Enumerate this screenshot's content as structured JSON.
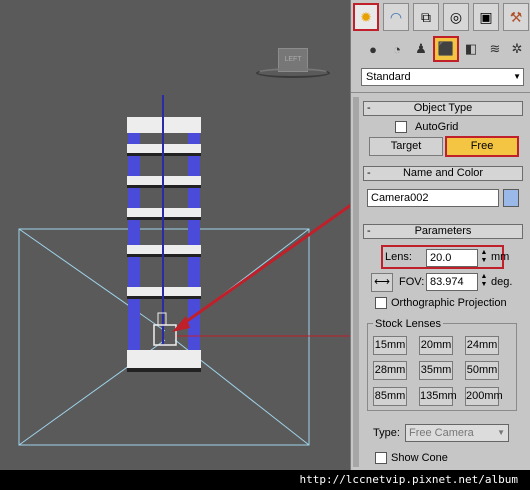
{
  "viewport": {
    "viewcube_label": "LEFT"
  },
  "panel": {
    "tabs": [
      {
        "name": "create",
        "icon": "sun-icon"
      },
      {
        "name": "modify",
        "icon": "arc-icon"
      },
      {
        "name": "hierarchy",
        "icon": "tree-icon"
      },
      {
        "name": "motion",
        "icon": "motion-icon"
      },
      {
        "name": "display",
        "icon": "monitor-icon"
      },
      {
        "name": "utilities",
        "icon": "hammer-icon"
      }
    ],
    "category_dropdown": "Standard",
    "object_type": {
      "title": "Object Type",
      "autogrid_label": "AutoGrid",
      "target_label": "Target",
      "free_label": "Free"
    },
    "name_and_color": {
      "title": "Name and Color",
      "name_value": "Camera002",
      "color": "#9bb9e8"
    },
    "parameters": {
      "title": "Parameters",
      "lens_label": "Lens:",
      "lens_value": "20.0",
      "lens_unit": "mm",
      "fov_label": "FOV:",
      "fov_value": "83.974",
      "fov_unit": "deg.",
      "ortho_label": "Orthographic Projection",
      "stock_lenses_label": "Stock Lenses",
      "stock_lenses": [
        "15mm",
        "20mm",
        "24mm",
        "28mm",
        "35mm",
        "50mm",
        "85mm",
        "135mm",
        "200mm"
      ],
      "type_label": "Type:",
      "type_value": "Free Camera",
      "show_cone_label": "Show Cone"
    }
  },
  "footer": {
    "watermark": "http://lccnetvip.pixnet.net/album"
  },
  "colors": {
    "accent_red": "#c0202a",
    "active_yellow": "#f3c543"
  }
}
